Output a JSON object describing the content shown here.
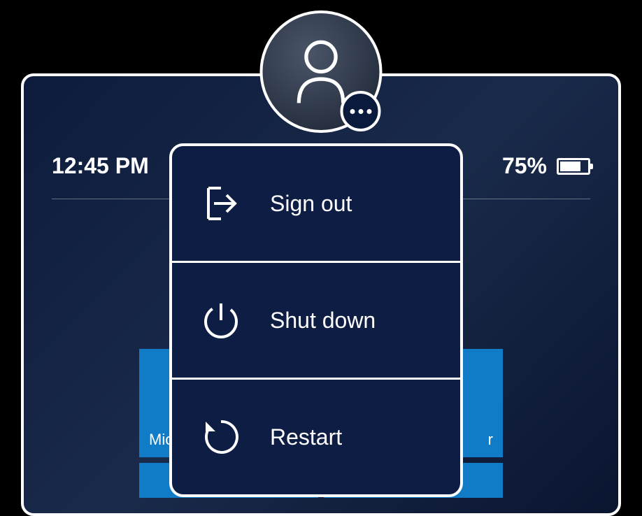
{
  "status": {
    "time": "12:45 PM",
    "battery_percent": "75%"
  },
  "tiles": {
    "row1": [
      {
        "label": "Mic"
      },
      {
        "label": "r"
      }
    ]
  },
  "power_menu": {
    "sign_out": "Sign out",
    "shut_down": "Shut down",
    "restart": "Restart"
  }
}
